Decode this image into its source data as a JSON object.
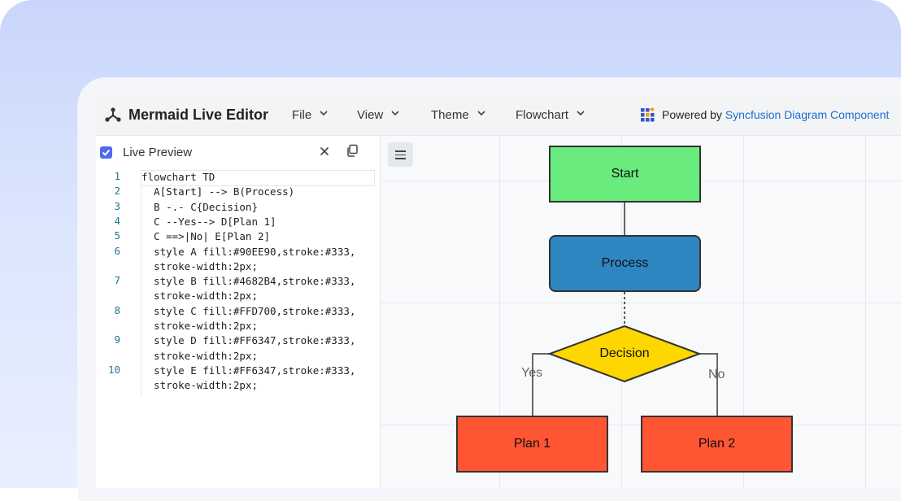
{
  "app": {
    "title": "Mermaid Live Editor",
    "menus": [
      {
        "label": "File"
      },
      {
        "label": "View"
      },
      {
        "label": "Theme"
      },
      {
        "label": "Flowchart"
      }
    ],
    "powered_by_prefix": "Powered by ",
    "powered_by_link": "Syncfusion Diagram Component"
  },
  "editor": {
    "live_preview_label": "Live Preview",
    "live_preview_checked": true,
    "lines": [
      {
        "num": "1",
        "text": "flowchart TD"
      },
      {
        "num": "2",
        "text": "  A[Start] --> B(Process)"
      },
      {
        "num": "3",
        "text": "  B -.- C{Decision}"
      },
      {
        "num": "4",
        "text": "  C --Yes--> D[Plan 1]"
      },
      {
        "num": "5",
        "text": "  C ==>|No| E[Plan 2]"
      },
      {
        "num": "6",
        "text": "  style A fill:#90EE90,stroke:#333,\n  stroke-width:2px;"
      },
      {
        "num": "7",
        "text": "  style B fill:#4682B4,stroke:#333,\n  stroke-width:2px;"
      },
      {
        "num": "8",
        "text": "  style C fill:#FFD700,stroke:#333,\n  stroke-width:2px;"
      },
      {
        "num": "9",
        "text": "  style D fill:#FF6347,stroke:#333,\n  stroke-width:2px;"
      },
      {
        "num": "10",
        "text": "  style E fill:#FF6347,stroke:#333,\n  stroke-width:2px;"
      }
    ]
  },
  "diagram": {
    "nodes": {
      "start": {
        "label": "Start",
        "fill": "#6AEB7E"
      },
      "process": {
        "label": "Process",
        "fill": "#2E86C1"
      },
      "decision": {
        "label": "Decision",
        "fill": "#FFD700"
      },
      "plan1": {
        "label": "Plan 1",
        "fill": "#FF5533"
      },
      "plan2": {
        "label": "Plan 2",
        "fill": "#FF5533"
      }
    },
    "edge_labels": {
      "yes": "Yes",
      "no": "No"
    }
  },
  "colors": {
    "accent": "#4F6AF0",
    "link": "#1A6FD1",
    "line_number": "#237893"
  }
}
